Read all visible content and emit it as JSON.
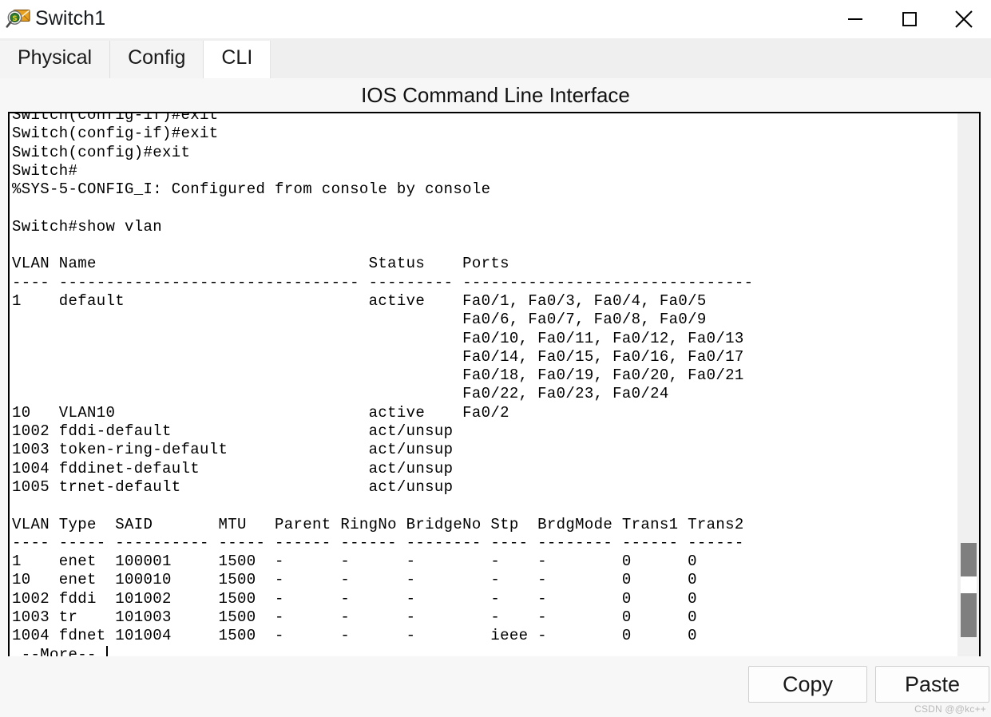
{
  "window": {
    "title": "Switch1",
    "icon": "packet-tracer-inspect-icon",
    "controls": {
      "minimize": "minimize-icon",
      "maximize": "maximize-icon",
      "close": "close-icon"
    }
  },
  "tabs": [
    {
      "label": "Physical",
      "active": false
    },
    {
      "label": "Config",
      "active": false
    },
    {
      "label": "CLI",
      "active": true
    }
  ],
  "cli": {
    "header_title": "IOS Command Line Interface",
    "lines": [
      "Switch(config-if)#exit",
      "Switch(config)#exit",
      "Switch#",
      "%SYS-5-CONFIG_I: Configured from console by console",
      "",
      "Switch#show vlan",
      "",
      "VLAN Name                             Status    Ports",
      "---- -------------------------------- --------- -------------------------------",
      "1    default                          active    Fa0/1, Fa0/3, Fa0/4, Fa0/5",
      "                                                Fa0/6, Fa0/7, Fa0/8, Fa0/9",
      "                                                Fa0/10, Fa0/11, Fa0/12, Fa0/13",
      "                                                Fa0/14, Fa0/15, Fa0/16, Fa0/17",
      "                                                Fa0/18, Fa0/19, Fa0/20, Fa0/21",
      "                                                Fa0/22, Fa0/23, Fa0/24",
      "10   VLAN10                           active    Fa0/2",
      "1002 fddi-default                     act/unsup",
      "1003 token-ring-default               act/unsup",
      "1004 fddinet-default                  act/unsup",
      "1005 trnet-default                    act/unsup",
      "",
      "VLAN Type  SAID       MTU   Parent RingNo BridgeNo Stp  BrdgMode Trans1 Trans2",
      "---- ----- ---------- ----- ------ ------ -------- ---- -------- ------ ------",
      "1    enet  100001     1500  -      -      -        -    -        0      0",
      "10   enet  100010     1500  -      -      -        -    -        0      0",
      "1002 fddi  101002     1500  -      -      -        -    -        0      0",
      "1003 tr    101003     1500  -      -      -        -    -        0      0",
      "1004 fdnet 101004     1500  -      -      -        ieee -        0      0"
    ],
    "more_prompt": " --More-- ",
    "scrollbar": "vertical-scrollbar"
  },
  "vlan_table": {
    "columns": [
      "VLAN",
      "Name",
      "Status",
      "Ports"
    ],
    "rows": [
      {
        "vlan": "1",
        "name": "default",
        "status": "active",
        "ports": [
          "Fa0/1",
          "Fa0/3",
          "Fa0/4",
          "Fa0/5",
          "Fa0/6",
          "Fa0/7",
          "Fa0/8",
          "Fa0/9",
          "Fa0/10",
          "Fa0/11",
          "Fa0/12",
          "Fa0/13",
          "Fa0/14",
          "Fa0/15",
          "Fa0/16",
          "Fa0/17",
          "Fa0/18",
          "Fa0/19",
          "Fa0/20",
          "Fa0/21",
          "Fa0/22",
          "Fa0/23",
          "Fa0/24"
        ]
      },
      {
        "vlan": "10",
        "name": "VLAN10",
        "status": "active",
        "ports": [
          "Fa0/2"
        ]
      },
      {
        "vlan": "1002",
        "name": "fddi-default",
        "status": "act/unsup",
        "ports": []
      },
      {
        "vlan": "1003",
        "name": "token-ring-default",
        "status": "act/unsup",
        "ports": []
      },
      {
        "vlan": "1004",
        "name": "fddinet-default",
        "status": "act/unsup",
        "ports": []
      },
      {
        "vlan": "1005",
        "name": "trnet-default",
        "status": "act/unsup",
        "ports": []
      }
    ]
  },
  "vlan_detail_table": {
    "columns": [
      "VLAN",
      "Type",
      "SAID",
      "MTU",
      "Parent",
      "RingNo",
      "BridgeNo",
      "Stp",
      "BrdgMode",
      "Trans1",
      "Trans2"
    ],
    "rows": [
      [
        "1",
        "enet",
        "100001",
        "1500",
        "-",
        "-",
        "-",
        "-",
        "-",
        "0",
        "0"
      ],
      [
        "10",
        "enet",
        "100010",
        "1500",
        "-",
        "-",
        "-",
        "-",
        "-",
        "0",
        "0"
      ],
      [
        "1002",
        "fddi",
        "101002",
        "1500",
        "-",
        "-",
        "-",
        "-",
        "-",
        "0",
        "0"
      ],
      [
        "1003",
        "tr",
        "101003",
        "1500",
        "-",
        "-",
        "-",
        "-",
        "-",
        "0",
        "0"
      ],
      [
        "1004",
        "fdnet",
        "101004",
        "1500",
        "-",
        "-",
        "-",
        "ieee",
        "-",
        "0",
        "0"
      ]
    ]
  },
  "bottom": {
    "copy_label": "Copy",
    "paste_label": "Paste",
    "watermark": "CSDN @@kc++"
  },
  "colors": {
    "terminal_bg": "#ffffff",
    "terminal_fg": "#000000",
    "chrome_bg": "#f7f7f7",
    "tab_inactive": "#f4f4f4",
    "tab_active": "#ffffff",
    "scroll_thumb": "#7f7f7f"
  }
}
